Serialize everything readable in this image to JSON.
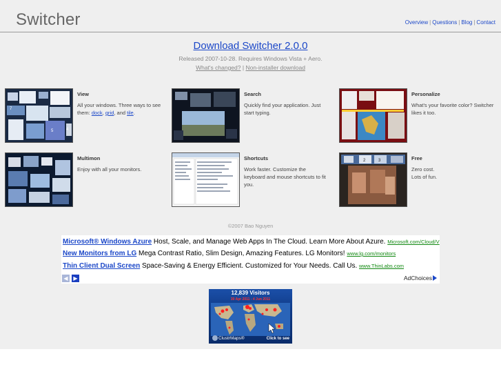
{
  "header": {
    "logo": "Switcher",
    "nav": [
      "Overview",
      "Questions",
      "Blog",
      "Contact"
    ]
  },
  "release": {
    "download_label": "Download Switcher 2.0.0",
    "released_text": "Released 2007-10-28. Requires Windows Vista + Aero.",
    "whats_changed": "What's changed?",
    "separator": "|",
    "non_installer": "Non-installer download"
  },
  "features": [
    {
      "title": "View",
      "desc_start": "All your windows. Three ways to see them: ",
      "link1": "dock",
      "sep1": ", ",
      "link2": "grid",
      "sep2": ", and ",
      "link3": "tile",
      "desc_end": "."
    },
    {
      "title": "Search",
      "desc": "Quickly find your application. Just start typing."
    },
    {
      "title": "Personalize",
      "desc": "What's your favorite color? Switcher likes it too."
    },
    {
      "title": "Multimon",
      "desc": "Enjoy with all your monitors."
    },
    {
      "title": "Shortcuts",
      "desc": "Work faster. Customize the keyboard and mouse shortcuts to fit you."
    },
    {
      "title": "Free",
      "desc": "Zero cost.\nLots of fun."
    }
  ],
  "thumb_numbers": {
    "view": [
      "7",
      "5",
      "4"
    ],
    "free": [
      "2",
      "3"
    ]
  },
  "footer": {
    "copyright": "©2007 Bao Nguyen"
  },
  "ads": [
    {
      "title": "Microsoft® Windows Azure",
      "text": " Host, Scale, and Manage Web Apps In The Cloud. Learn More About Azure. ",
      "url": "Microsoft.com/Cloud/V"
    },
    {
      "title": "New Monitors from LG",
      "text": " Mega Contrast Ratio, Slim Design, Amazing Features. LG Monitors! ",
      "url": "www.lg.com/monitors"
    },
    {
      "title": "Thin Client Dual Screen",
      "text": " Space-Saving & Energy Efficient. Customized for Your Needs. Call Us. ",
      "url": "www.ThinLabs.com"
    }
  ],
  "adchoices": "AdChoices",
  "clustrmaps": {
    "visitors": "12,839 Visitors",
    "range": "30 Apr 2011 - 4 Jun 2011",
    "brand": "ClustrMaps®",
    "cta": "Click to see"
  },
  "colors": {
    "link": "#1b47c8",
    "ad_url": "#118811",
    "background": "#efefef"
  }
}
